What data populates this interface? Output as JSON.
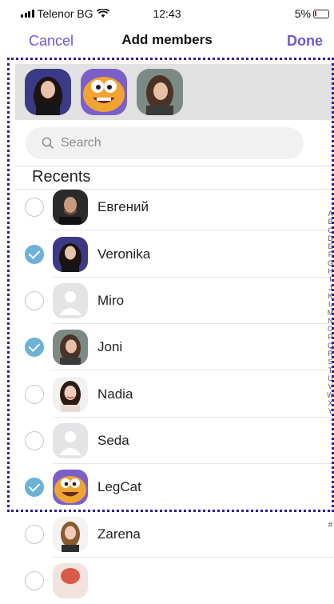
{
  "status": {
    "carrier": "Telenor BG",
    "time": "12:43",
    "battery": "5%"
  },
  "nav": {
    "cancel": "Cancel",
    "title": "Add members",
    "done": "Done"
  },
  "selected": [
    {
      "name": "Veronika",
      "avatar": "woman-dark-hair-photo"
    },
    {
      "name": "LegCat",
      "avatar": "cartoon-cat-avatar"
    },
    {
      "name": "Joni",
      "avatar": "woman-portrait-photo"
    }
  ],
  "search": {
    "placeholder": "Search"
  },
  "section": {
    "recents": "Recents"
  },
  "contacts": [
    {
      "name": "Евгений",
      "checked": false
    },
    {
      "name": "Veronika",
      "checked": true
    },
    {
      "name": "Miro",
      "checked": false
    },
    {
      "name": "Joni",
      "checked": true
    },
    {
      "name": "Nadia",
      "checked": false
    },
    {
      "name": "Seda",
      "checked": false
    },
    {
      "name": "LegCat",
      "checked": true
    },
    {
      "name": "Zarena",
      "checked": false
    }
  ],
  "index_letters": [
    "A",
    "B",
    "C",
    "D",
    "E",
    "F",
    "G",
    "H",
    "I",
    "J",
    "K",
    "L",
    "M",
    "N",
    "O",
    "P",
    "Q",
    "R",
    "S",
    "T",
    "U",
    "V",
    "W",
    "X",
    "Y"
  ],
  "index_hash": "#",
  "colors": {
    "accent": "#6d5ad8",
    "check": "#6cb1d6",
    "focus_frame": "#2a1f9e"
  }
}
